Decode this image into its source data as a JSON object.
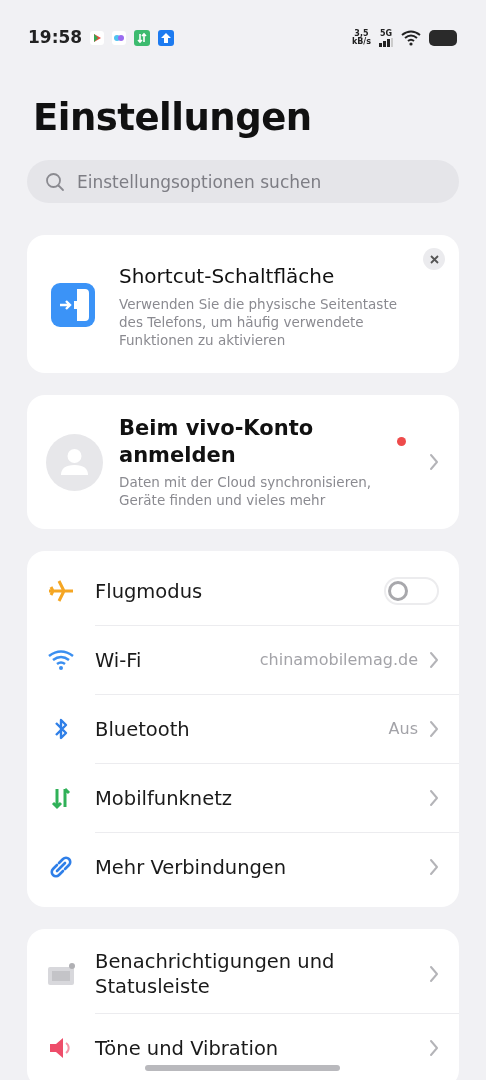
{
  "status_bar": {
    "time": "19:58",
    "speed_value": "3,5",
    "speed_unit": "kB/s",
    "network": "5G"
  },
  "title": "Einstellungen",
  "search": {
    "placeholder": "Einstellungsoptionen suchen"
  },
  "shortcut_card": {
    "title": "Shortcut-Schaltfläche",
    "description": "Verwenden Sie die physische Seitentaste des Telefons, um häufig verwendete Funktionen zu aktivieren"
  },
  "account_card": {
    "title": "Beim vivo-Konto anmelden",
    "description": "Daten mit der Cloud synchronisieren, Geräte finden und vieles mehr",
    "notification_dot": true
  },
  "groups": [
    {
      "items": [
        {
          "kind": "toggle",
          "label": "Flugmodus",
          "on": false
        },
        {
          "kind": "link",
          "label": "Wi-Fi",
          "value": "chinamobilemag.de"
        },
        {
          "kind": "link",
          "label": "Bluetooth",
          "value": "Aus"
        },
        {
          "kind": "link",
          "label": "Mobilfunknetz"
        },
        {
          "kind": "link",
          "label": "Mehr Verbindungen"
        }
      ]
    },
    {
      "items": [
        {
          "kind": "link",
          "label": "Benachrichtigungen und Statusleiste"
        },
        {
          "kind": "link",
          "label": "Töne und Vibration"
        }
      ]
    }
  ]
}
